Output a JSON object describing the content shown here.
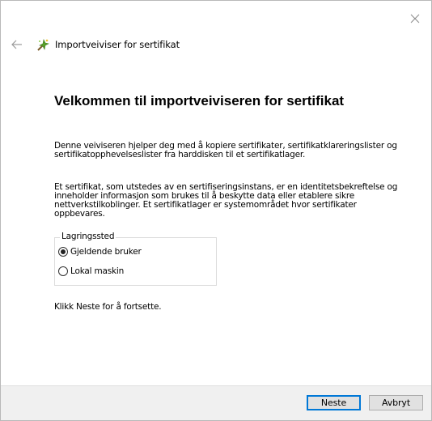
{
  "window": {
    "title": "Importveiviser for sertifikat"
  },
  "main": {
    "heading": "Velkommen til importveiviseren for sertifikat",
    "intro": "Denne veiviseren hjelper deg med å kopiere sertifikater, sertifikatklareringslister og sertifikatopphevelseslister fra harddisken til et sertifikatlager.",
    "description": "Et sertifikat, som utstedes av en sertifiseringsinstans, er en identitetsbekreftelse og inneholder informasjon som brukes til å beskytte data eller etablere sikre nettverkstilkoblinger. Et sertifikatlager er systemområdet hvor sertifikater oppbevares.",
    "storage_group": {
      "legend": "Lagringssted",
      "options": [
        {
          "label": "Gjeldende bruker",
          "checked": true
        },
        {
          "label": "Lokal maskin",
          "checked": false
        }
      ]
    },
    "instruction": "Klikk Neste for å fortsette."
  },
  "footer": {
    "next_label": "Neste",
    "cancel_label": "Avbryt"
  },
  "colors": {
    "accent": "#0078d7",
    "footer_bg": "#f0f0f0",
    "icon_green": "#5aa02c"
  },
  "icons": {
    "close": "close-icon",
    "back": "back-arrow-icon",
    "wizard": "certificate-wizard-icon"
  }
}
